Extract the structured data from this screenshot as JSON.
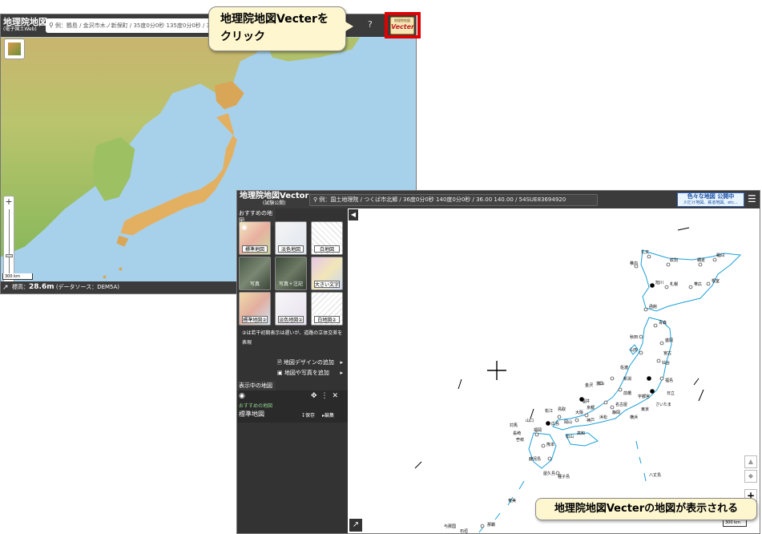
{
  "callouts": {
    "click_vecter": "地理院地図Vecterを\nクリック",
    "click_vecter_line1": "地理院地図Vecterを",
    "click_vecter_line2": "クリック",
    "displayed": "地理院地図Vecterの地図が表示される"
  },
  "gsi_map": {
    "title": "地理院地図",
    "subtitle": "(電子国土Web)",
    "search_placeholder": "例：鶴島 / 金沢市木ノ新保町 / 35度0分0秒 135度0分0秒 / 35.0",
    "help_icon": "?",
    "vecter_button_top": "地理院地図",
    "vecter_button_label": "Vecter",
    "zoom_in": "+",
    "zoom_out": "−",
    "scale_label": "300 km",
    "elevation_prefix": "標高：",
    "elevation_value": "28.6m",
    "data_source": "(データソース：DEM5A)"
  },
  "vecter_map": {
    "title": "地理院地図Vector",
    "subtitle": "(試験公開)",
    "search_placeholder": "例：国土地理院 / つくば市北郷 / 36度0分0秒 140度0分0秒 / 36.00 140.00 / 54SUE83694920",
    "banner_line1": "色々な地図 公開中",
    "banner_line2": "川だけ地図、鉄道地図、etc...",
    "section_recommended": "おすすめの地図",
    "tiles": [
      {
        "label": "標準地図"
      },
      {
        "label": "淡色地図"
      },
      {
        "label": "白地図"
      },
      {
        "label": "写真"
      },
      {
        "label": "写真＋注記"
      },
      {
        "label": "大きい文字"
      },
      {
        "label": "標準地図②"
      },
      {
        "label": "淡色地図②"
      },
      {
        "label": "白地図②"
      }
    ],
    "note": "②は若干初期表示は遅いが、道路の立体交差を表現",
    "add_design": "地図デザインの追加",
    "add_photo": "地図や写真を追加",
    "section_displayed": "表示中の地図",
    "current_group": "おすすめの地図",
    "current_name": "標準地図",
    "save_label": "保存",
    "edit_label": "編集",
    "scale_label": "300 km",
    "cities": [
      "礼文",
      "稚内",
      "紋別",
      "網走",
      "羅臼",
      "旭川",
      "札幌",
      "帯広",
      "根室",
      "函館",
      "青森",
      "秋田",
      "盛岡",
      "宮古",
      "山形",
      "仙台",
      "新潟",
      "福島",
      "佐渡",
      "日立",
      "宇都宮",
      "前橋",
      "さいたま",
      "東京",
      "横浜",
      "富山",
      "金沢",
      "福井",
      "名古屋",
      "静岡",
      "浜松",
      "京都",
      "大阪",
      "神戸",
      "松江",
      "鳥取",
      "岡山",
      "広島",
      "山口",
      "福岡",
      "長崎",
      "熊本",
      "鹿児島",
      "高知",
      "松山",
      "対馬",
      "壱岐",
      "種子島",
      "屋久島",
      "奄美",
      "那覇",
      "石垣",
      "与那国",
      "八丈島",
      "父島"
    ]
  }
}
